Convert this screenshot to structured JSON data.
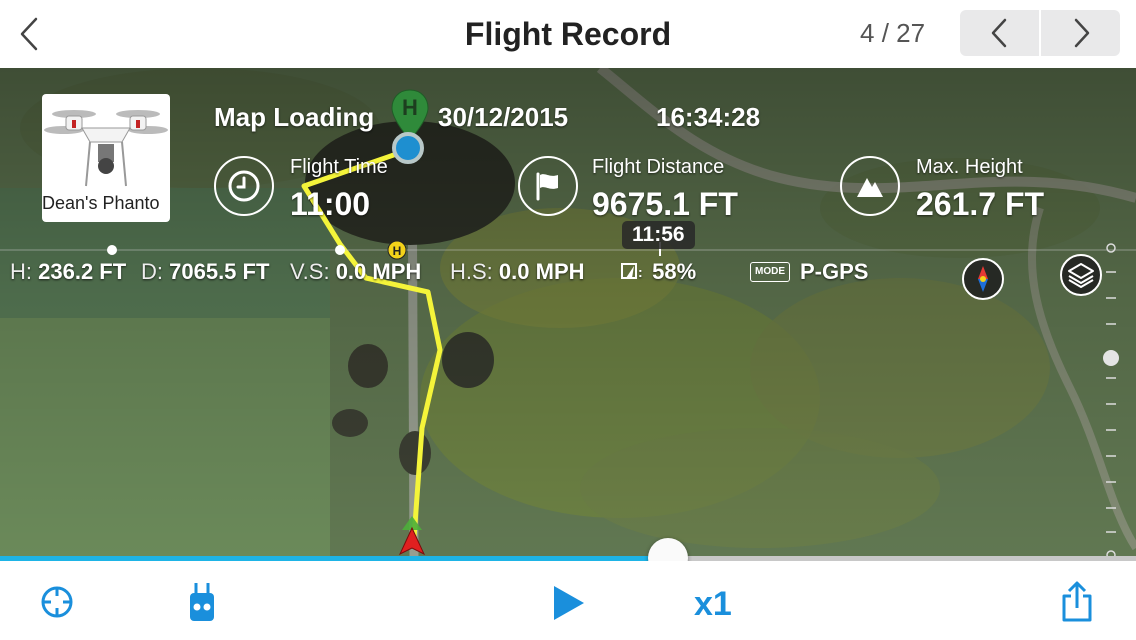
{
  "header": {
    "title": "Flight Record",
    "page_current": "4",
    "page_separator": "/",
    "page_total": "27"
  },
  "drone": {
    "name": "Dean's Phanto"
  },
  "info": {
    "map_status": "Map Loading",
    "date": "30/12/2015",
    "time": "16:34:28",
    "home_marker": "H"
  },
  "stats": {
    "flight_time_label": "Flight Time",
    "flight_time_value": "11:00",
    "flight_distance_label": "Flight Distance",
    "flight_distance_value": "9675.1 FT",
    "max_height_label": "Max. Height",
    "max_height_value": "261.7 FT"
  },
  "timeline": {
    "current_time": "11:56",
    "home_marker": "H"
  },
  "telemetry": {
    "h_label": "H:",
    "h_value": "236.2 FT",
    "d_label": "D:",
    "d_value": "7065.5 FT",
    "vs_label": "V.S:",
    "vs_value": "0.0 MPH",
    "hs_label": "H.S:",
    "hs_value": "0.0 MPH",
    "battery_value": "58%",
    "mode_tag": "MODE",
    "mode_value": "P-GPS"
  },
  "playback": {
    "progress_fraction": 0.586,
    "speed": "x1"
  },
  "colors": {
    "accent": "#1eb4e6",
    "speed_text": "#1a8fdc",
    "path": "#f4f43a"
  }
}
